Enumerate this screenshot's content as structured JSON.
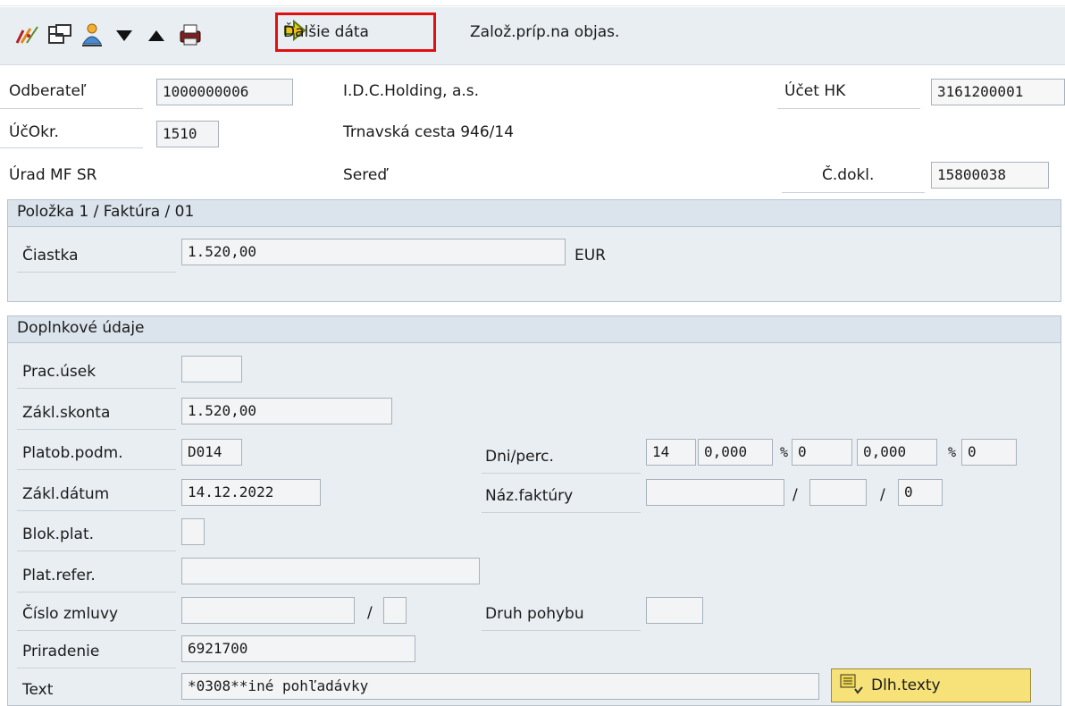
{
  "toolbar": {
    "next_data_label": "Ďalšie dáta",
    "create_case_label": "Založ.príp.na objas.",
    "icons": [
      "edit-icon",
      "layout-icon",
      "person-icon",
      "triangle-down-icon",
      "triangle-up-icon",
      "print-icon",
      "arrow-right-icon"
    ]
  },
  "header": {
    "customer_label": "Odberateľ",
    "customer_value": "1000000006",
    "customer_name": "I.D.C.Holding, a.s.",
    "gl_account_label": "Účet HK",
    "gl_account_value": "3161200001",
    "company_code_label": "ÚčOkr.",
    "company_code_value": "1510",
    "street": "Trnavská cesta 946/14",
    "office": "Úrad MF SR",
    "city": "Sereď",
    "doc_no_label": "Č.dokl.",
    "doc_no_value": "15800038"
  },
  "item_group": {
    "title": "Položka 1 / Faktúra / 01",
    "amount_label": "Čiastka",
    "amount_value": "1.520,00",
    "currency": "EUR"
  },
  "additional_group": {
    "title": "Doplnkové údaje",
    "business_area_label": "Prac.úsek",
    "business_area_value": "",
    "discount_base_label": "Zákl.skonta",
    "discount_base_value": "1.520,00",
    "payment_terms_label": "Platob.podm.",
    "payment_terms_value": "D014",
    "days_perc_label": "Dni/perc.",
    "days1": "14",
    "perc1": "0,000",
    "days2": "0",
    "perc2": "0,000",
    "days3": "0",
    "pct_symbol": "%",
    "baseline_date_label": "Zákl.dátum",
    "baseline_date_value": "14.12.2022",
    "invoice_ref_label": "Náz.faktúry",
    "invoice_ref_1": "",
    "invoice_ref_2": "",
    "invoice_ref_3": "0",
    "slash": "/",
    "payment_block_label": "Blok.plat.",
    "payment_block_value": "",
    "payment_ref_label": "Plat.refer.",
    "payment_ref_value": "",
    "contract_label": "Číslo zmluvy",
    "contract_value": "",
    "contract_type_value": "",
    "movement_type_label": "Druh pohybu",
    "movement_type_value": "",
    "assignment_label": "Priradenie",
    "assignment_value": "6921700",
    "text_label": "Text",
    "text_value": "*0308**iné pohľadávky",
    "long_texts_label": "Dlh.texty"
  },
  "colors": {
    "accent_red": "#e01010",
    "panel": "#e9eef3",
    "button_yellow": "#f7e27a"
  }
}
